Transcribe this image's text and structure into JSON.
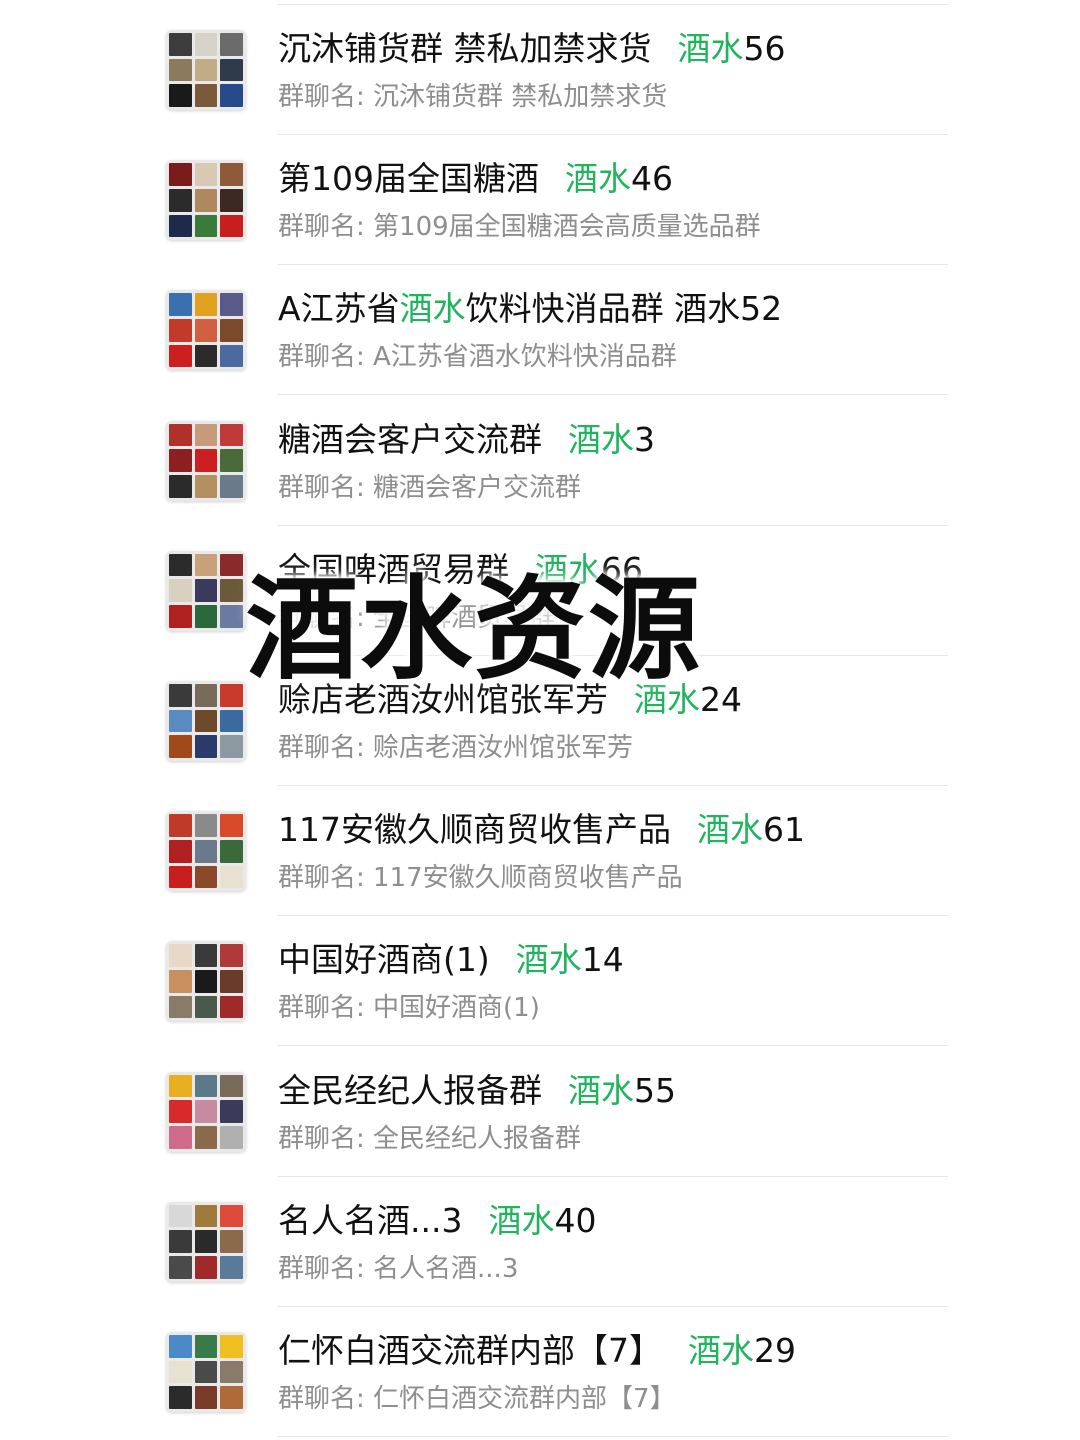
{
  "keyword": "酒水",
  "overlay_text": "酒水资源",
  "colors": {
    "keyword_green": "#21b45e",
    "title_black": "#111111",
    "subtitle_gray": "#8e8e8e"
  },
  "groups": [
    {
      "title_pre": "沉沐铺货群 禁私加禁求货",
      "keyword": "酒水",
      "number": "56",
      "subtitle": "群聊名: 沉沐铺货群 禁私加禁求货",
      "avatar_icon": "group-avatar-icon",
      "avatar_colors": [
        "#3c3c3c",
        "#d7d2c8",
        "#6b6b6b",
        "#8c7a5c",
        "#c2ac86",
        "#2f3a4a",
        "#1a1a1a",
        "#7a5a3a",
        "#274b8a"
      ]
    },
    {
      "title_pre": "第109届全国糖酒",
      "keyword": "酒水",
      "number": "46",
      "subtitle": "群聊名: 第109届全国糖酒会高质量选品群",
      "avatar_icon": "group-avatar-icon",
      "avatar_colors": [
        "#7a1b1b",
        "#d9c8b4",
        "#8e5a3a",
        "#2b2b2b",
        "#b08860",
        "#3c2a22",
        "#1d2a4a",
        "#3a7a3a",
        "#c81e1e"
      ]
    },
    {
      "title_pre": "A江苏省",
      "keyword": "酒水",
      "number": "",
      "title_post": "饮料快消品群 酒水52",
      "subtitle": "群聊名: A江苏省酒水饮料快消品群",
      "avatar_icon": "group-avatar-icon",
      "avatar_colors": [
        "#3a6fb0",
        "#e0a020",
        "#5a5a8a",
        "#c23a2a",
        "#d06040",
        "#7a4a2a",
        "#cc1f1f",
        "#2b2b2b",
        "#4a6aa0"
      ]
    },
    {
      "title_pre": "糖酒会客户交流群",
      "keyword": "酒水",
      "number": "3",
      "subtitle": "群聊名: 糖酒会客户交流群",
      "avatar_icon": "group-avatar-icon",
      "avatar_colors": [
        "#b0302a",
        "#c79a7a",
        "#c03a3a",
        "#8a2020",
        "#cc2020",
        "#4a6a3a",
        "#2b2b2b",
        "#b49060",
        "#6a7a8a"
      ]
    },
    {
      "title_pre": "全国啤酒贸易群",
      "keyword": "酒水",
      "number": "66",
      "subtitle": "群聊名: 全国啤酒贸易群",
      "avatar_icon": "group-avatar-icon",
      "avatar_colors": [
        "#2b2b2b",
        "#c8a07a",
        "#8a2a2a",
        "#d8d0c0",
        "#3a3a5a",
        "#6a5a3a",
        "#b02020",
        "#2a6a3a",
        "#6a7aa0"
      ]
    },
    {
      "title_pre": "赊店老酒汝州馆张军芳",
      "keyword": "酒水",
      "number": "24",
      "subtitle": "群聊名: 赊店老酒汝州馆张军芳",
      "avatar_icon": "group-avatar-icon",
      "avatar_colors": [
        "#3a3a3a",
        "#7a6a5a",
        "#c83a2a",
        "#5a8ac0",
        "#6a4a2a",
        "#3a6aa0",
        "#a04a1a",
        "#2a3a6a",
        "#8a9aa0"
      ]
    },
    {
      "title_pre": "117安徽久顺商贸收售产品",
      "keyword": "酒水",
      "number": "61",
      "subtitle": "群聊名: 117安徽久顺商贸收售产品",
      "avatar_icon": "group-avatar-icon",
      "avatar_colors": [
        "#c03a2a",
        "#8a8a8a",
        "#d84a2a",
        "#b02020",
        "#6a7a8a",
        "#3a6a3a",
        "#c81e1e",
        "#8a4a2a",
        "#e8e0d0"
      ]
    },
    {
      "title_pre": "中国好酒商(1)",
      "keyword": "酒水",
      "number": "14",
      "subtitle": "群聊名: 中国好酒商(1)",
      "avatar_icon": "group-avatar-icon",
      "avatar_colors": [
        "#e8d8c8",
        "#3a3a3a",
        "#b03a3a",
        "#c89060",
        "#1a1a1a",
        "#6a3a2a",
        "#8a7a6a",
        "#4a5a4a",
        "#a02a2a"
      ]
    },
    {
      "title_pre": "全民经纪人报备群",
      "keyword": "酒水",
      "number": "55",
      "subtitle": "群聊名: 全民经纪人报备群",
      "avatar_icon": "group-avatar-icon",
      "avatar_colors": [
        "#e8b020",
        "#5a7a8a",
        "#7a6a5a",
        "#d82a2a",
        "#c88aa0",
        "#3a3a5a",
        "#d06a8a",
        "#8a6a4a",
        "#b0b0b0"
      ]
    },
    {
      "title_pre": "名人名酒...3",
      "keyword": "酒水",
      "number": "40",
      "subtitle": "群聊名: 名人名酒...3",
      "avatar_icon": "group-avatar-icon",
      "avatar_colors": [
        "#d8d8d8",
        "#a07a3a",
        "#e04a3a",
        "#3a3a3a",
        "#2a2a2a",
        "#8a6a4a",
        "#4a4a4a",
        "#a02a2a",
        "#5a7a9a"
      ]
    },
    {
      "title_pre": "仁怀白酒交流群内部【7】",
      "keyword": "酒水",
      "number": "29",
      "subtitle": "群聊名: 仁怀白酒交流群内部【7】",
      "avatar_icon": "group-avatar-icon",
      "avatar_colors": [
        "#4a8ac8",
        "#3a7a4a",
        "#f0c020",
        "#e8e0d0",
        "#4a4a4a",
        "#8a7a6a",
        "#2b2b2b",
        "#7a3a2a",
        "#b06a3a"
      ]
    }
  ]
}
